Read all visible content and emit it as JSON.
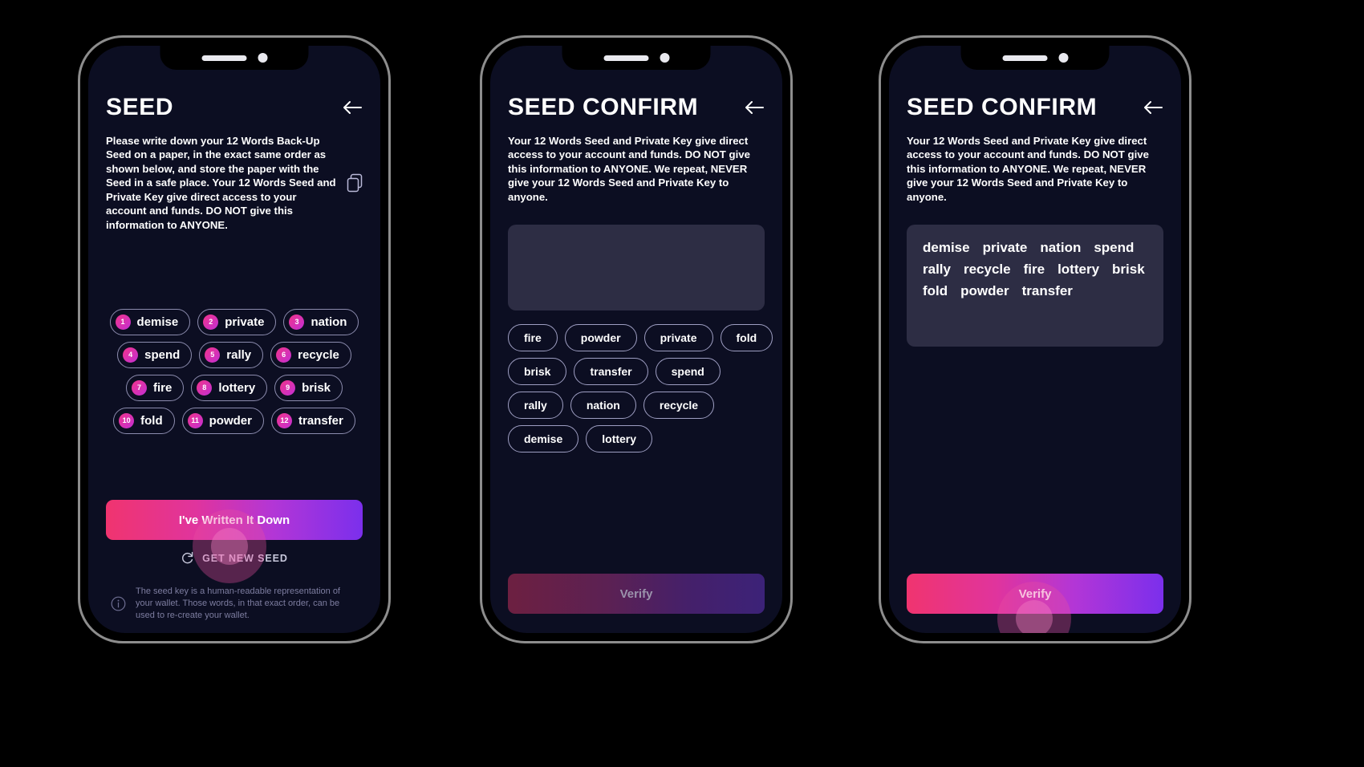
{
  "screens": [
    {
      "id": "seed",
      "title": "SEED",
      "back_icon": "arrow-left-icon",
      "copy_icon": "copy-icon",
      "intro": "Please write down your 12 Words Back-Up Seed on a paper, in the exact same order as shown below, and store the paper with the Seed in a safe place. Your 12 Words Seed and Private Key give direct access to your account and funds. DO NOT give this information to ANYONE.",
      "seed_rows": [
        [
          {
            "n": "1",
            "word": "demise"
          },
          {
            "n": "2",
            "word": "private"
          },
          {
            "n": "3",
            "word": "nation"
          }
        ],
        [
          {
            "n": "4",
            "word": "spend"
          },
          {
            "n": "5",
            "word": "rally"
          },
          {
            "n": "6",
            "word": "recycle"
          }
        ],
        [
          {
            "n": "7",
            "word": "fire"
          },
          {
            "n": "8",
            "word": "lottery"
          },
          {
            "n": "9",
            "word": "brisk"
          }
        ],
        [
          {
            "n": "10",
            "word": "fold"
          },
          {
            "n": "11",
            "word": "powder"
          },
          {
            "n": "12",
            "word": "transfer"
          }
        ]
      ],
      "primary_button": "I've Written It Down",
      "secondary_button": "GET NEW SEED",
      "refresh_icon": "refresh-icon",
      "info_icon": "info-icon",
      "footer_note": "The seed key is a human-readable representation of your wallet. Those words, in that exact order, can be used to re-create your wallet."
    },
    {
      "id": "seed-confirm-empty",
      "title": "SEED CONFIRM",
      "back_icon": "arrow-left-icon",
      "intro": "Your 12 Words Seed and Private Key give direct access to your account and funds. DO NOT give this information to ANYONE. We repeat, NEVER give your 12 Words Seed and Private Key to anyone.",
      "selected_words": [],
      "pool_rows": [
        [
          "fire",
          "powder",
          "private",
          "fold"
        ],
        [
          "brisk",
          "transfer",
          "spend"
        ],
        [
          "rally",
          "nation",
          "recycle"
        ],
        [
          "demise",
          "lottery"
        ]
      ],
      "primary_button": "Verify",
      "primary_button_state": "disabled"
    },
    {
      "id": "seed-confirm-filled",
      "title": "SEED CONFIRM",
      "back_icon": "arrow-left-icon",
      "intro": "Your 12 Words Seed and Private Key give direct access to your account and funds. DO NOT give this information to ANYONE. We repeat, NEVER give your 12 Words Seed and Private Key to anyone.",
      "selected_words": [
        "demise",
        "private",
        "nation",
        "spend",
        "rally",
        "recycle",
        "fire",
        "lottery",
        "brisk",
        "fold",
        "powder",
        "transfer"
      ],
      "pool_rows": [],
      "primary_button": "Verify",
      "primary_button_state": "enabled"
    }
  ],
  "colors": {
    "background": "#000000",
    "screen_bg": "#0c0e22",
    "accent_pink": "#f0346f",
    "accent_purple": "#7b2fec",
    "chip_border": "#9e9ec2",
    "dropbox_bg": "#2d2d44",
    "muted_text": "#7d7da0"
  }
}
